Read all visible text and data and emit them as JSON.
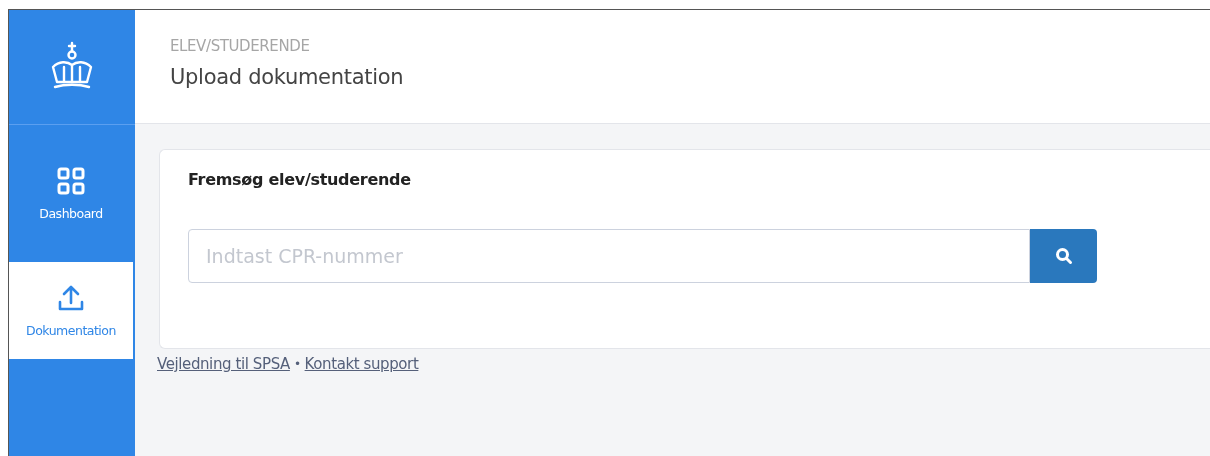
{
  "header": {
    "breadcrumb": "ELEV/STUDERENDE",
    "title": "Upload dokumentation"
  },
  "sidebar": {
    "items": [
      {
        "label": "Dashboard",
        "kind": "grid",
        "selected": false
      },
      {
        "label": "Dokumentation",
        "kind": "upload",
        "selected": true
      }
    ]
  },
  "search_card": {
    "title": "Fremsøg elev/studerende",
    "placeholder": "Indtast CPR-nummer"
  },
  "footer": {
    "links": [
      "Vejledning til SPSA",
      "Kontakt support"
    ],
    "separator": "•"
  }
}
